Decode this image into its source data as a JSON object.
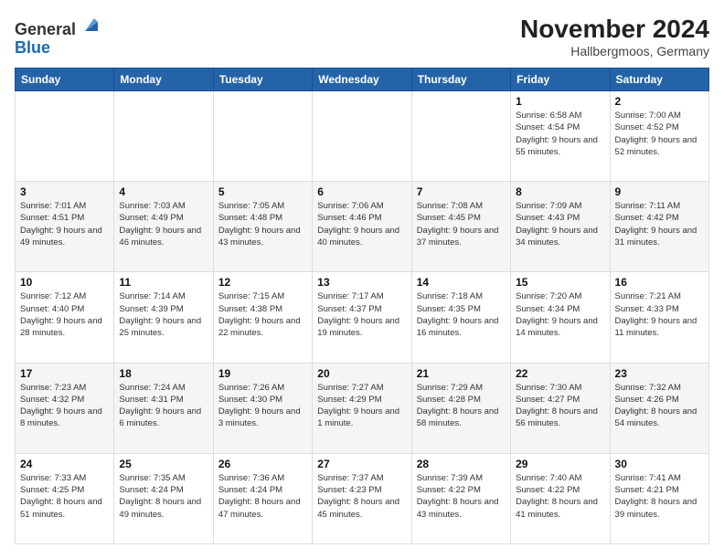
{
  "header": {
    "logo": {
      "line1": "General",
      "line2": "Blue"
    },
    "title": "November 2024",
    "location": "Hallbergmoos, Germany"
  },
  "days_of_week": [
    "Sunday",
    "Monday",
    "Tuesday",
    "Wednesday",
    "Thursday",
    "Friday",
    "Saturday"
  ],
  "weeks": [
    [
      {
        "day": "",
        "info": ""
      },
      {
        "day": "",
        "info": ""
      },
      {
        "day": "",
        "info": ""
      },
      {
        "day": "",
        "info": ""
      },
      {
        "day": "",
        "info": ""
      },
      {
        "day": "1",
        "info": "Sunrise: 6:58 AM\nSunset: 4:54 PM\nDaylight: 9 hours and 55 minutes."
      },
      {
        "day": "2",
        "info": "Sunrise: 7:00 AM\nSunset: 4:52 PM\nDaylight: 9 hours and 52 minutes."
      }
    ],
    [
      {
        "day": "3",
        "info": "Sunrise: 7:01 AM\nSunset: 4:51 PM\nDaylight: 9 hours and 49 minutes."
      },
      {
        "day": "4",
        "info": "Sunrise: 7:03 AM\nSunset: 4:49 PM\nDaylight: 9 hours and 46 minutes."
      },
      {
        "day": "5",
        "info": "Sunrise: 7:05 AM\nSunset: 4:48 PM\nDaylight: 9 hours and 43 minutes."
      },
      {
        "day": "6",
        "info": "Sunrise: 7:06 AM\nSunset: 4:46 PM\nDaylight: 9 hours and 40 minutes."
      },
      {
        "day": "7",
        "info": "Sunrise: 7:08 AM\nSunset: 4:45 PM\nDaylight: 9 hours and 37 minutes."
      },
      {
        "day": "8",
        "info": "Sunrise: 7:09 AM\nSunset: 4:43 PM\nDaylight: 9 hours and 34 minutes."
      },
      {
        "day": "9",
        "info": "Sunrise: 7:11 AM\nSunset: 4:42 PM\nDaylight: 9 hours and 31 minutes."
      }
    ],
    [
      {
        "day": "10",
        "info": "Sunrise: 7:12 AM\nSunset: 4:40 PM\nDaylight: 9 hours and 28 minutes."
      },
      {
        "day": "11",
        "info": "Sunrise: 7:14 AM\nSunset: 4:39 PM\nDaylight: 9 hours and 25 minutes."
      },
      {
        "day": "12",
        "info": "Sunrise: 7:15 AM\nSunset: 4:38 PM\nDaylight: 9 hours and 22 minutes."
      },
      {
        "day": "13",
        "info": "Sunrise: 7:17 AM\nSunset: 4:37 PM\nDaylight: 9 hours and 19 minutes."
      },
      {
        "day": "14",
        "info": "Sunrise: 7:18 AM\nSunset: 4:35 PM\nDaylight: 9 hours and 16 minutes."
      },
      {
        "day": "15",
        "info": "Sunrise: 7:20 AM\nSunset: 4:34 PM\nDaylight: 9 hours and 14 minutes."
      },
      {
        "day": "16",
        "info": "Sunrise: 7:21 AM\nSunset: 4:33 PM\nDaylight: 9 hours and 11 minutes."
      }
    ],
    [
      {
        "day": "17",
        "info": "Sunrise: 7:23 AM\nSunset: 4:32 PM\nDaylight: 9 hours and 8 minutes."
      },
      {
        "day": "18",
        "info": "Sunrise: 7:24 AM\nSunset: 4:31 PM\nDaylight: 9 hours and 6 minutes."
      },
      {
        "day": "19",
        "info": "Sunrise: 7:26 AM\nSunset: 4:30 PM\nDaylight: 9 hours and 3 minutes."
      },
      {
        "day": "20",
        "info": "Sunrise: 7:27 AM\nSunset: 4:29 PM\nDaylight: 9 hours and 1 minute."
      },
      {
        "day": "21",
        "info": "Sunrise: 7:29 AM\nSunset: 4:28 PM\nDaylight: 8 hours and 58 minutes."
      },
      {
        "day": "22",
        "info": "Sunrise: 7:30 AM\nSunset: 4:27 PM\nDaylight: 8 hours and 56 minutes."
      },
      {
        "day": "23",
        "info": "Sunrise: 7:32 AM\nSunset: 4:26 PM\nDaylight: 8 hours and 54 minutes."
      }
    ],
    [
      {
        "day": "24",
        "info": "Sunrise: 7:33 AM\nSunset: 4:25 PM\nDaylight: 8 hours and 51 minutes."
      },
      {
        "day": "25",
        "info": "Sunrise: 7:35 AM\nSunset: 4:24 PM\nDaylight: 8 hours and 49 minutes."
      },
      {
        "day": "26",
        "info": "Sunrise: 7:36 AM\nSunset: 4:24 PM\nDaylight: 8 hours and 47 minutes."
      },
      {
        "day": "27",
        "info": "Sunrise: 7:37 AM\nSunset: 4:23 PM\nDaylight: 8 hours and 45 minutes."
      },
      {
        "day": "28",
        "info": "Sunrise: 7:39 AM\nSunset: 4:22 PM\nDaylight: 8 hours and 43 minutes."
      },
      {
        "day": "29",
        "info": "Sunrise: 7:40 AM\nSunset: 4:22 PM\nDaylight: 8 hours and 41 minutes."
      },
      {
        "day": "30",
        "info": "Sunrise: 7:41 AM\nSunset: 4:21 PM\nDaylight: 8 hours and 39 minutes."
      }
    ]
  ]
}
